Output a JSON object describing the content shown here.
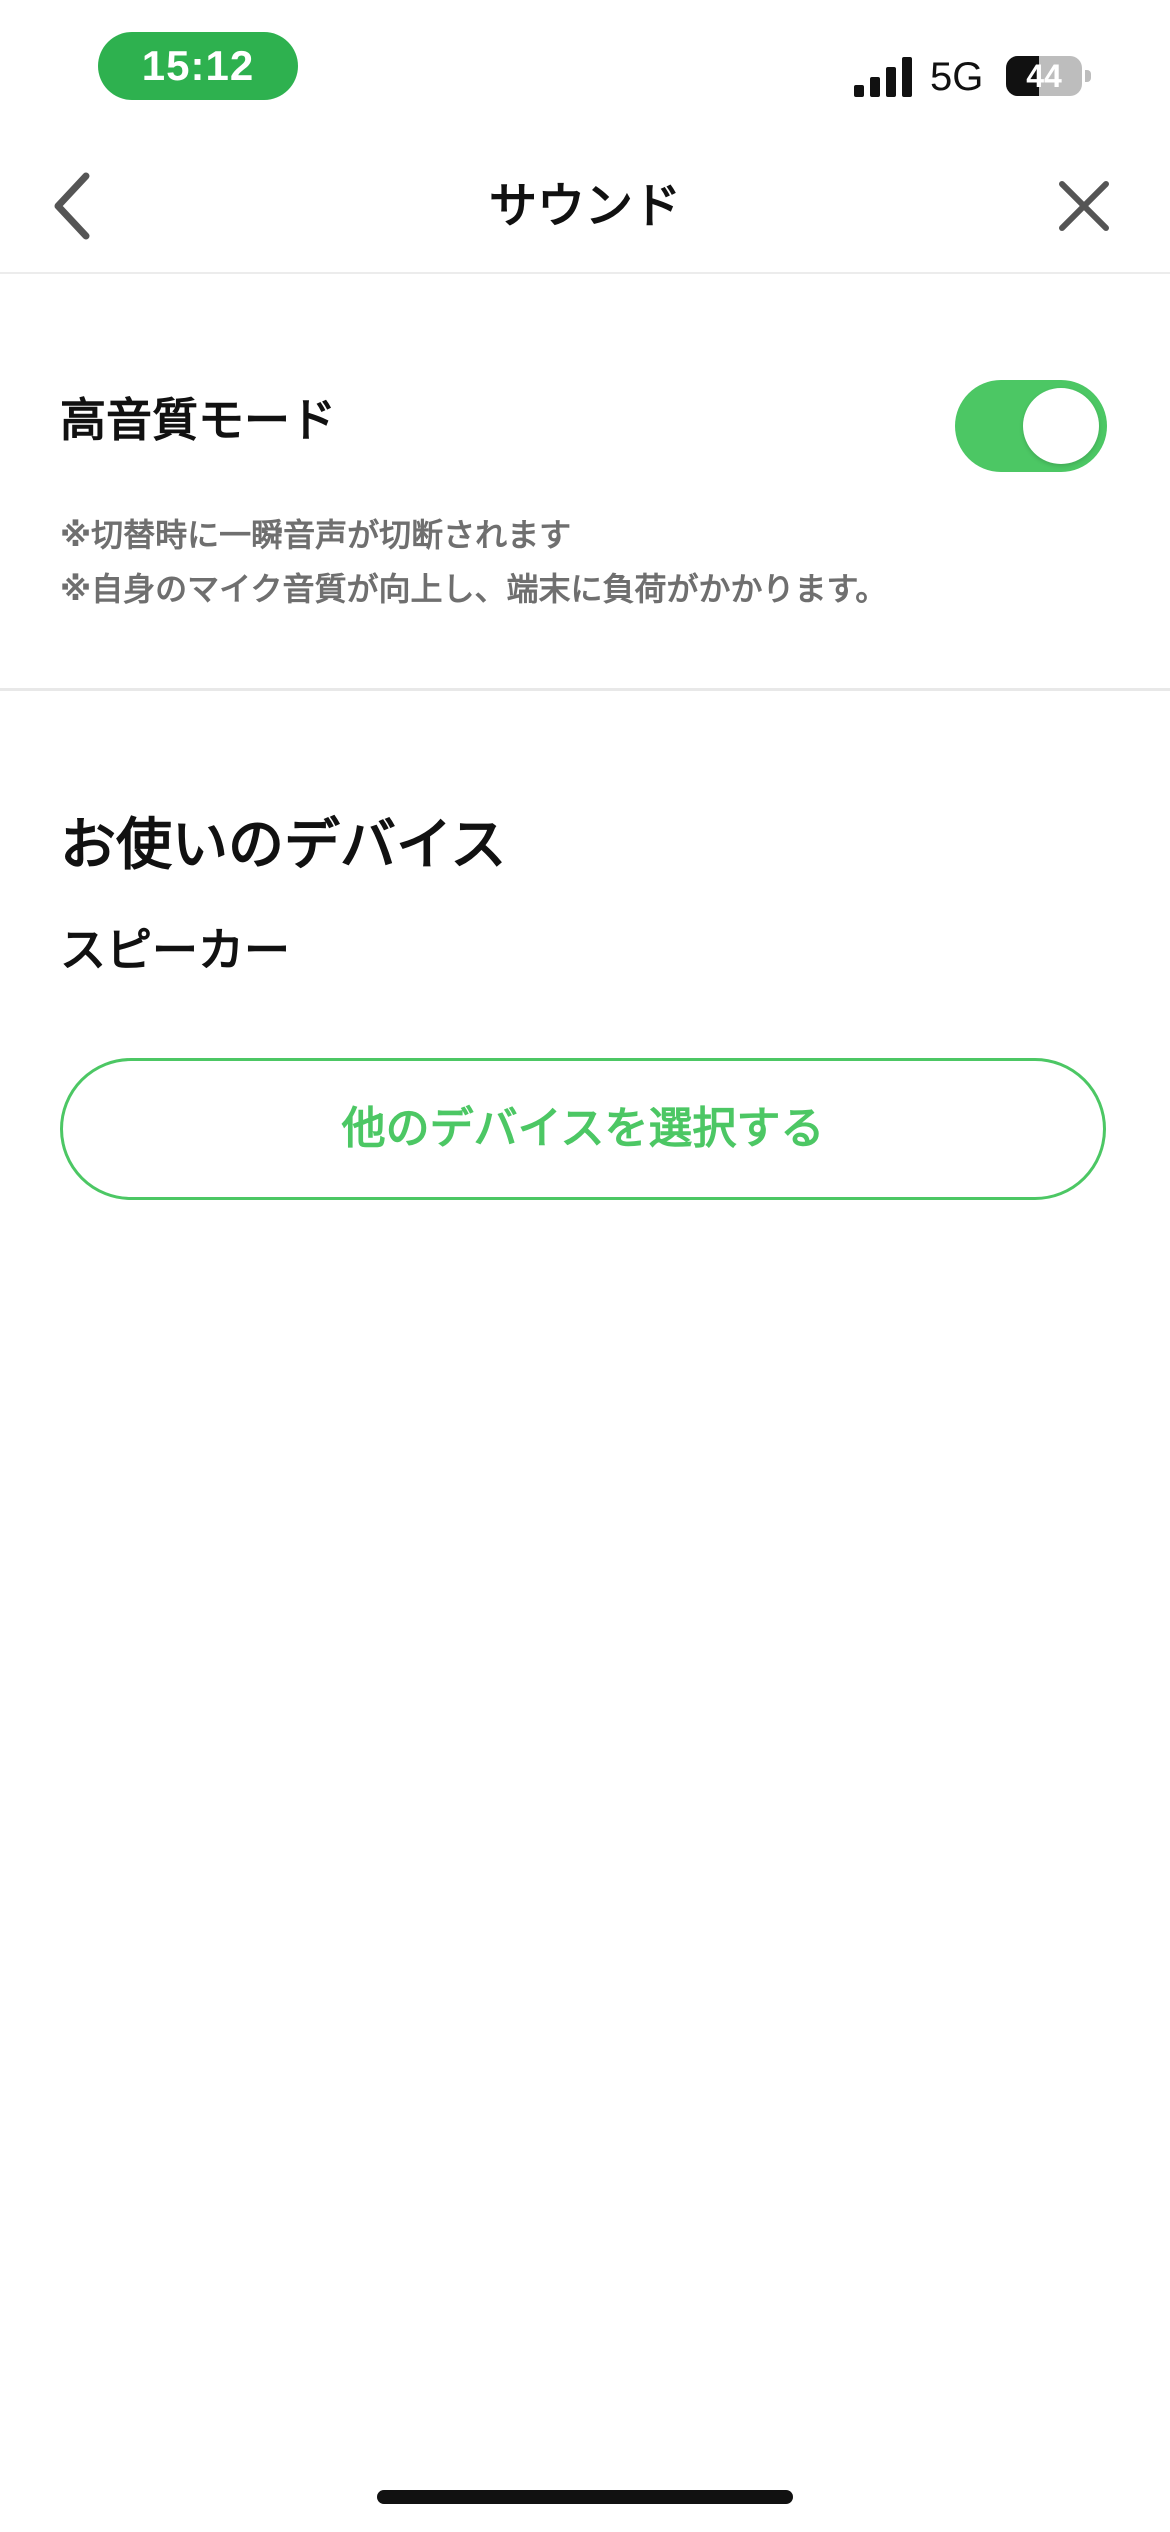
{
  "status_bar": {
    "time": "15:12",
    "time_pill_color": "#2eb14f",
    "network": "5G",
    "signal_icon": "cellular-signal-icon",
    "battery_level_text": "44",
    "battery_level_percent": 44
  },
  "nav": {
    "title": "サウンド",
    "back_icon": "chevron-left-icon",
    "close_icon": "close-icon"
  },
  "high_quality": {
    "label": "高音質モード",
    "enabled": true,
    "toggle_color": "#4cc764",
    "notes": [
      "※切替時に一瞬音声が切断されます",
      "※自身のマイク音質が向上し、端末に負荷がかかります。"
    ]
  },
  "devices": {
    "heading": "お使いのデバイス",
    "current": "スピーカー",
    "select_button_label": "他のデバイスを選択する",
    "accent_color": "#4cc764"
  }
}
